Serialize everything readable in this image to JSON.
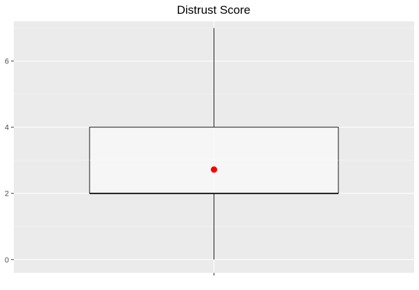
{
  "chart_data": {
    "type": "boxplot",
    "title": "Distrust Score",
    "xlabel": "",
    "ylabel": "",
    "ylim": [
      -0.4,
      7.2
    ],
    "y_ticks": [
      0,
      2,
      4,
      6
    ],
    "y_tick_labels": [
      "0",
      "2",
      "4",
      "6"
    ],
    "grid": true,
    "legend": "none",
    "box": {
      "min": 0,
      "q1": 2,
      "median": 2,
      "q3": 4,
      "max": 7,
      "mean": 2.72
    },
    "colors": {
      "panel_background": "#EBEBEB",
      "grid_major": "#FFFFFF",
      "grid_minor": "#F5F5F5",
      "box_fill": "#F8F8F8",
      "box_stroke": "#000000",
      "mean_point": "#FF0000",
      "tick_text": "#4D4D4D"
    }
  }
}
